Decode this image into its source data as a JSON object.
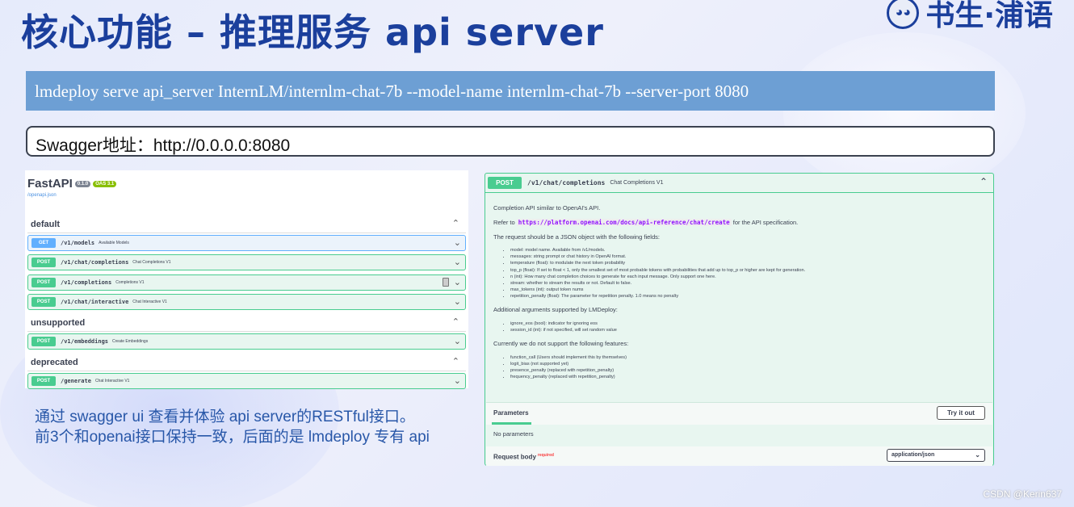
{
  "slide": {
    "title": "核心功能 – 推理服务 api server",
    "logo_text": "书生·浦语",
    "command": "lmdeploy serve api_server InternLM/internlm-chat-7b --model-name internlm-chat-7b --server-port 8080",
    "swagger": "Swagger地址：http://0.0.0.0:8080",
    "desc_line1": "通过 swagger ui 查看并体验 api server的RESTful接口。",
    "desc_line2": "前3个和openai接口保持一致，后面的是 lmdeploy 专有 api",
    "credit": "CSDN @Kerin637"
  },
  "fastapi": {
    "title": "FastAPI",
    "version": "0.1.0",
    "oas": "OAS 3.1",
    "link": "/openapi.json",
    "groups": [
      {
        "name": "default",
        "ops": [
          {
            "method": "GET",
            "path": "/v1/models",
            "summary": "Available Models"
          },
          {
            "method": "POST",
            "path": "/v1/chat/completions",
            "summary": "Chat Completions V1"
          },
          {
            "method": "POST",
            "path": "/v1/completions",
            "summary": "Completions V1"
          },
          {
            "method": "POST",
            "path": "/v1/chat/interactive",
            "summary": "Chat Interactive V1"
          }
        ]
      },
      {
        "name": "unsupported",
        "ops": [
          {
            "method": "POST",
            "path": "/v1/embeddings",
            "summary": "Create Embeddings"
          }
        ]
      },
      {
        "name": "deprecated",
        "ops": [
          {
            "method": "POST",
            "path": "/generate",
            "summary": "Chat Interactive V1"
          }
        ]
      }
    ]
  },
  "detail": {
    "method": "POST",
    "path": "/v1/chat/completions",
    "summary": "Chat Completions V1",
    "intro": "Completion API similar to OpenAI's API.",
    "refer_prefix": "Refer to",
    "refer_link": "https://platform.openai.com/docs/api-reference/chat/create",
    "refer_suffix": "for the API specification.",
    "fields_intro": "The request should be a JSON object with the following fields:",
    "fields": [
      "model: model name. Available from /v1/models.",
      "messages: string prompt or chat history in OpenAI format.",
      "temperature (float): to modulate the next token probability",
      "top_p (float): If set to float < 1, only the smallest set of most probable tokens with probabilities that add up to top_p or higher are kept for generation.",
      "n (int): How many chat completion choices to generate for each input message. Only support one here.",
      "stream: whether to stream the results or not. Default to false.",
      "max_tokens (int): output token nums",
      "repetition_penalty (float): The parameter for repetition penalty. 1.0 means no penalty"
    ],
    "additional_intro": "Additional arguments supported by LMDeploy:",
    "additional": [
      "ignore_eos (bool): indicator for ignoring eos",
      "session_id (int): if not specified, will set random value"
    ],
    "unsupported_intro": "Currently we do not support the following features:",
    "unsupported": [
      "function_call (Users should implement this by themselves)",
      "logit_bias (not supported yet)",
      "presence_penalty (replaced with repetition_penalty)",
      "frequency_penalty (replaced with repetition_penalty)"
    ],
    "parameters_label": "Parameters",
    "try_label": "Try it out",
    "no_params": "No parameters",
    "request_body_label": "Request body",
    "required_label": "required",
    "content_type": "application/json"
  },
  "colors": {
    "title": "#1b3f9c",
    "command_bar": "#6d9fd4",
    "get": "#61affe",
    "post": "#49cc90",
    "desc": "#2857a8"
  }
}
